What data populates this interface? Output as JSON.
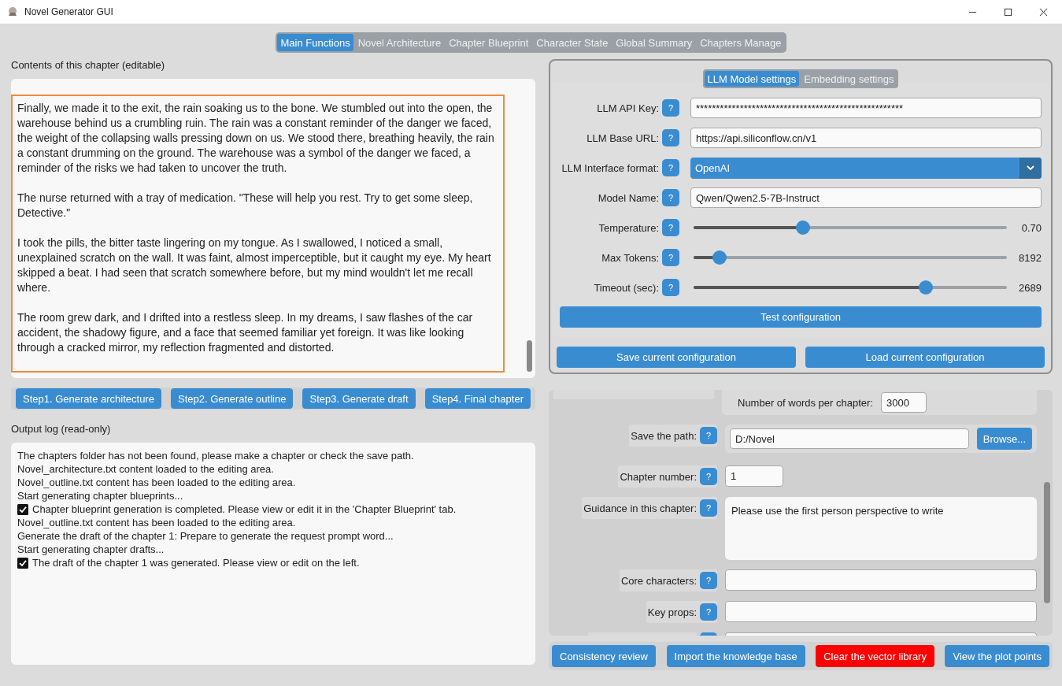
{
  "window": {
    "title": "Novel Generator GUI"
  },
  "tabs": [
    {
      "label": "Main Functions",
      "selected": true
    },
    {
      "label": "Novel Architecture",
      "selected": false
    },
    {
      "label": "Chapter Blueprint",
      "selected": false
    },
    {
      "label": "Character State",
      "selected": false
    },
    {
      "label": "Global Summary",
      "selected": false
    },
    {
      "label": "Chapters Manage",
      "selected": false
    }
  ],
  "chapter_editor": {
    "label": "Contents of this chapter (editable)",
    "paragraphs": [
      "Finally, we made it to the exit, the rain soaking us to the bone. We stumbled out into the open, the warehouse behind us a crumbling ruin. The rain was a constant reminder of the danger we faced, the weight of the collapsing walls pressing down on us. We stood there, breathing heavily, the rain a constant drumming on the ground. The warehouse was a symbol of the danger we faced, a reminder of the risks we had taken to uncover the truth.",
      "The nurse returned with a tray of medication. \"These will help you rest. Try to get some sleep, Detective.\"",
      "I took the pills, the bitter taste lingering on my tongue. As I swallowed, I noticed a small, unexplained scratch on the wall. It was faint, almost imperceptible, but it caught my eye. My heart skipped a beat. I had seen that scratch somewhere before, but my mind wouldn't let me recall where.",
      "The room grew dark, and I drifted into a restless sleep. In my dreams, I saw flashes of the car accident, the shadowy figure, and a face that seemed familiar yet foreign. It was like looking through a cracked mirror, my reflection fragmented and distorted."
    ]
  },
  "step_buttons": [
    "Step1. Generate architecture",
    "Step2. Generate outline",
    "Step3. Generate draft",
    "Step4. Final chapter"
  ],
  "output_log": {
    "label": "Output log (read-only)",
    "lines": [
      {
        "kind": "plain",
        "text": "The chapters folder has not been found, please make a chapter or check the save path."
      },
      {
        "kind": "plain",
        "text": "Novel_architecture.txt content loaded to the editing area."
      },
      {
        "kind": "plain",
        "text": "Novel_outline.txt content has been loaded to the editing area."
      },
      {
        "kind": "plain",
        "text": "Start generating chapter blueprints..."
      },
      {
        "kind": "check",
        "text": "Chapter blueprint generation is completed. Please view or edit it in the 'Chapter Blueprint' tab."
      },
      {
        "kind": "plain",
        "text": "Novel_outline.txt content has been loaded to the editing area."
      },
      {
        "kind": "plain",
        "text": "Generate the draft of the chapter 1: Prepare to generate the request prompt word..."
      },
      {
        "kind": "plain",
        "text": "Start generating chapter drafts..."
      },
      {
        "kind": "check",
        "text": "The draft of the chapter 1 was generated. Please view or edit on the left."
      }
    ]
  },
  "settings_tabs": [
    {
      "label": "LLM Model settings",
      "selected": true
    },
    {
      "label": "Embedding settings",
      "selected": false
    }
  ],
  "llm_settings": [
    {
      "kind": "text",
      "label": "LLM API Key:",
      "help": "?",
      "value": "****************************************************"
    },
    {
      "kind": "text",
      "label": "LLM Base URL:",
      "help": "?",
      "value": "https://api.siliconflow.cn/v1"
    },
    {
      "kind": "select",
      "label": "LLM Interface format:",
      "help": "?",
      "value": "OpenAI"
    },
    {
      "kind": "text",
      "label": "Model Name:",
      "help": "?",
      "value": "Qwen/Qwen2.5-7B-Instruct"
    },
    {
      "kind": "slider",
      "label": "Temperature:",
      "help": "?",
      "level": 0.35,
      "reading": "0.70"
    },
    {
      "kind": "slider",
      "label": "Max Tokens:",
      "help": "?",
      "level": 0.083,
      "reading": "8192"
    },
    {
      "kind": "slider",
      "label": "Timeout (sec):",
      "help": "?",
      "level": 0.74,
      "reading": "2689"
    }
  ],
  "test_button": "Test configuration",
  "config_buttons": [
    "Save current configuration",
    "Load current configuration"
  ],
  "chapter_params": {
    "words_per_chapter": {
      "label": "Number of words per chapter:",
      "value": "3000"
    },
    "fields": [
      {
        "kind": "path",
        "label": "Save the path:",
        "help": "?",
        "value": "D:/Novel",
        "button": "Browse..."
      },
      {
        "kind": "short",
        "label": "Chapter number:",
        "help": "?",
        "value": "1"
      },
      {
        "kind": "multiline",
        "label": "Guidance in this chapter:",
        "help": "?",
        "value": "Please use the first person perspective to write"
      },
      {
        "kind": "line",
        "label": "Core characters:",
        "help": "?"
      },
      {
        "kind": "line",
        "label": "Key props:",
        "help": "?"
      }
    ]
  },
  "action_buttons": [
    {
      "label": "Consistency review",
      "kind": "normal"
    },
    {
      "label": "Import the knowledge base",
      "kind": "normal"
    },
    {
      "label": "Clear the vector library",
      "kind": "danger"
    },
    {
      "label": "View the plot points",
      "kind": "normal"
    }
  ]
}
